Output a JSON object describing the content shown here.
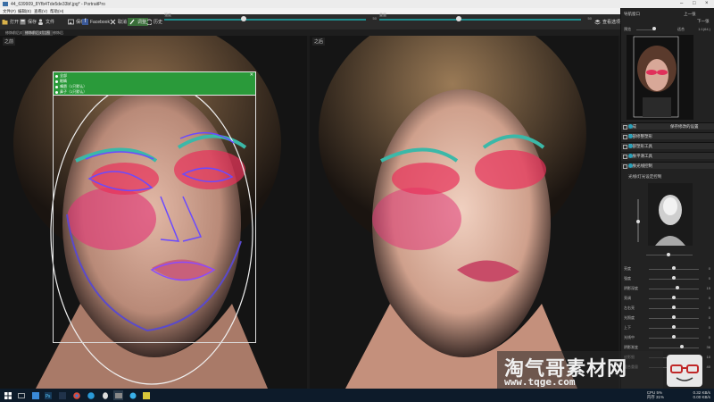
{
  "window": {
    "title": "44_639909_8Yfb4Tde5de33bf.jpg* - PortraitPro",
    "menu": [
      "文件(F)",
      "编辑(E)",
      "查看(V)",
      "帮助(H)"
    ]
  },
  "toolbar": {
    "open_label": "打开",
    "save_label": "保存",
    "detect_label": "文件",
    "share_label": "发送到",
    "save_image_label": "保存",
    "facebook_label": "Facebook",
    "cancel_label": "取消",
    "edit_label": "调整",
    "history_label": "历史",
    "slider1_label": "强度",
    "slider1_value": "50",
    "slider2_label": "重量",
    "slider2_value": "50",
    "view_label": "查看选项"
  },
  "subtabs": [
    "修饰前后对比",
    "修饰前后对比图",
    "修饰后"
  ],
  "panes": {
    "left_label": "之前",
    "right_label": "之后"
  },
  "face_dialog": {
    "items": [
      "全部",
      "眼睛",
      "嘴唇（1只默认）",
      "鼻子（1只默认）"
    ]
  },
  "right_panel": {
    "title": "导航窗口",
    "nav_labels": [
      "上一张",
      "下一张"
    ],
    "view_label": "预览",
    "zoom_value": "1:1(64.)",
    "fit_label": "适合",
    "sections": [
      {
        "label": "完成",
        "extra": "保存修改的设置"
      },
      {
        "label": "面部修整塑形"
      },
      {
        "label": "面部塑形工具"
      },
      {
        "label": "皮肤平滑工具"
      },
      {
        "label": "皮肤光线控制"
      }
    ],
    "lighting_label": "光线/灯光设定控制",
    "sliders": [
      {
        "name": "亮度",
        "value": "0"
      },
      {
        "name": "强度",
        "value": "0"
      },
      {
        "name": "阴影深度",
        "value": "15"
      },
      {
        "name": "亮调",
        "value": "0"
      },
      {
        "name": "左右亮",
        "value": "0"
      },
      {
        "name": "光照度",
        "value": "0"
      },
      {
        "name": "上下",
        "value": "0"
      },
      {
        "name": "光线中",
        "value": "0"
      },
      {
        "name": "阴影渐变",
        "value": "36"
      },
      {
        "name": "皮影细",
        "value": "10"
      },
      {
        "name": "混合重量",
        "value": "40"
      }
    ]
  },
  "taskbar": {
    "net_up": "0.32 KB/s",
    "net_down": "0.00 KB/s",
    "cpu": "CPU 5%",
    "mem": "内存 31%"
  },
  "watermark": {
    "text": "淘气哥素材网",
    "url": "www.tqge.com"
  },
  "colors": {
    "accent_green": "#2a9a3a",
    "slider_teal": "#1f8c8c",
    "help_blue": "#2aa0b8"
  }
}
